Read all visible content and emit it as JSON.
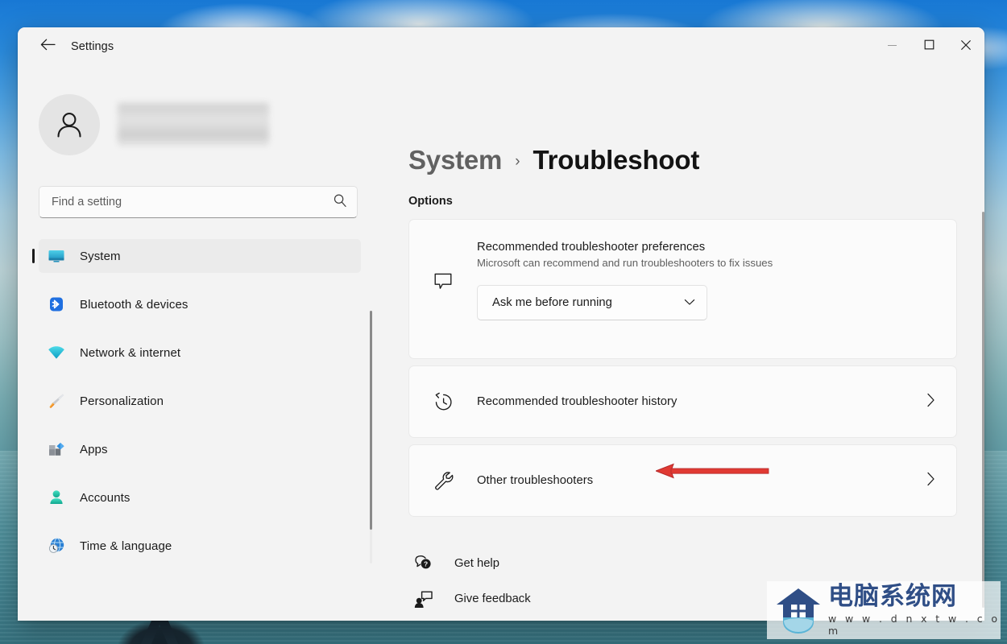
{
  "window": {
    "app_title": "Settings",
    "back_icon": "arrow-left-icon",
    "controls": {
      "minimize": "minimize-icon",
      "maximize": "maximize-icon",
      "close": "close-icon"
    }
  },
  "sidebar": {
    "avatar_icon": "person-avatar-icon",
    "account_name_redacted": "",
    "search": {
      "placeholder": "Find a setting",
      "value": "",
      "icon": "search-icon"
    },
    "items": [
      {
        "label": "System",
        "icon": "monitor-icon",
        "active": true
      },
      {
        "label": "Bluetooth & devices",
        "icon": "bluetooth-icon",
        "active": false
      },
      {
        "label": "Network & internet",
        "icon": "wifi-icon",
        "active": false
      },
      {
        "label": "Personalization",
        "icon": "paintbrush-icon",
        "active": false
      },
      {
        "label": "Apps",
        "icon": "apps-icon",
        "active": false
      },
      {
        "label": "Accounts",
        "icon": "account-icon",
        "active": false
      },
      {
        "label": "Time & language",
        "icon": "globe-clock-icon",
        "active": false
      }
    ]
  },
  "main": {
    "breadcrumb": {
      "parent": "System",
      "separator": "›",
      "current": "Troubleshoot"
    },
    "section_label": "Options",
    "cards": [
      {
        "title": "Recommended troubleshooter preferences",
        "subtitle": "Microsoft can recommend and run troubleshooters to fix issues",
        "icon": "speech-bubble-icon",
        "dropdown": {
          "value": "Ask me before running",
          "chevron": "chevron-down-icon"
        }
      },
      {
        "title": "Recommended troubleshooter history",
        "subtitle": "",
        "icon": "history-clock-icon",
        "chevron": "chevron-right-icon"
      },
      {
        "title": "Other troubleshooters",
        "subtitle": "",
        "icon": "wrench-icon",
        "chevron": "chevron-right-icon"
      }
    ],
    "links": [
      {
        "label": "Get help",
        "icon": "help-bubble-icon"
      },
      {
        "label": "Give feedback",
        "icon": "feedback-person-icon"
      }
    ]
  },
  "annotation": {
    "type": "arrow-left",
    "color": "#e03a33",
    "points_to": "Other troubleshooters"
  },
  "watermark": {
    "name_cn": "电脑系统网",
    "url": "w w w . d n x t w . c o m",
    "logo_icon": "house-shield-logo",
    "color": "#2f4e86"
  },
  "colors": {
    "window_bg": "#f3f3f3",
    "card_bg": "#fbfbfb",
    "accent_selected": "#ebebeb",
    "text_primary": "#1b1b1b",
    "text_secondary": "#5f5f5f",
    "annotation_red": "#e03a33"
  }
}
